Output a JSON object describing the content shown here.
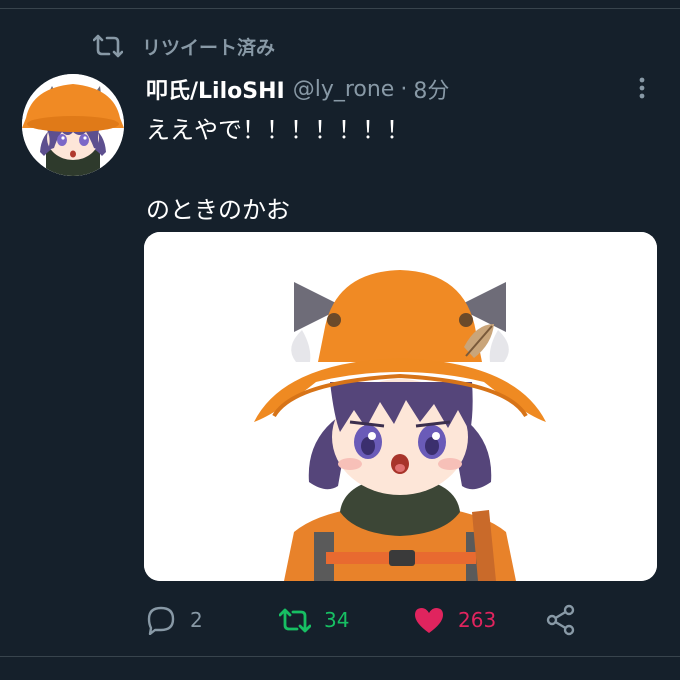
{
  "colors": {
    "background": "#15202b",
    "secondary_text": "#8899a6",
    "retweet_green": "#17bf63",
    "like_pink": "#e0245e",
    "divider": "#38444d"
  },
  "retweet_banner": {
    "icon": "retweet-icon",
    "label": "リツイート済み"
  },
  "tweet": {
    "display_name": "叩氏/LiloSHI",
    "handle": "@ly_rone",
    "separator": "·",
    "time": "8分",
    "text_lines": [
      "ええやで！！！！！！！",
      "",
      "のときのかお"
    ],
    "more_icon": "more-vertical-icon"
  },
  "actions": {
    "reply_count": "2",
    "retweet_count": "34",
    "like_count": "263",
    "reply_icon": "reply-icon",
    "retweet_icon": "retweet-icon",
    "like_icon": "heart-icon",
    "share_icon": "share-icon"
  }
}
